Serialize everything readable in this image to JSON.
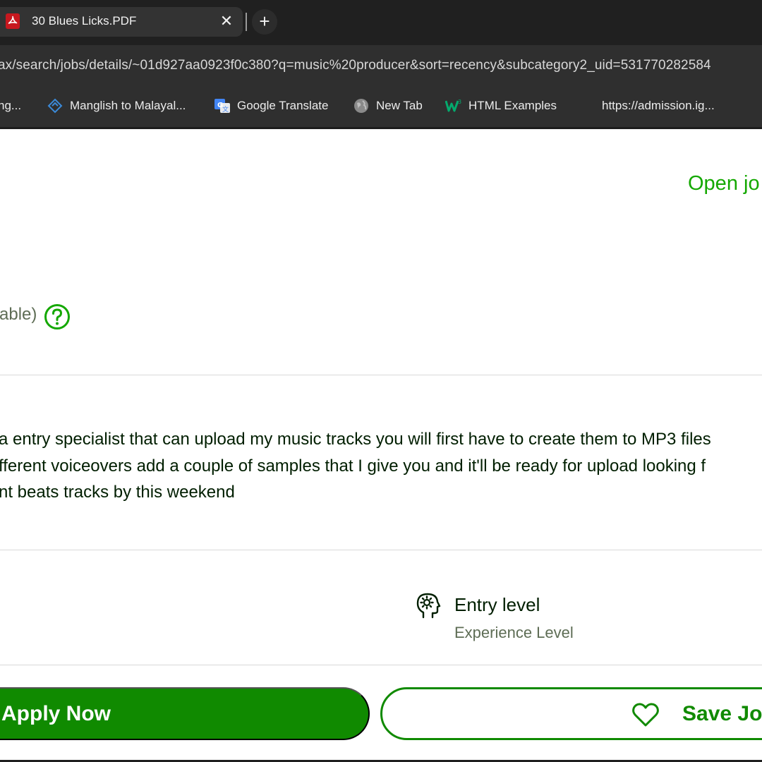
{
  "browser": {
    "tab": {
      "title": "30 Blues Licks.PDF",
      "close_glyph": "✕",
      "icon": "pdf-icon"
    },
    "new_tab_glyph": "+",
    "url": "ax/search/jobs/details/~01d927aa0923f0c380?q=music%20producer&sort=recency&subcategory2_uid=531770282584",
    "bookmarks": [
      {
        "label": "ng...",
        "icon": "none"
      },
      {
        "label": "Manglish to Malayal...",
        "icon": "diamond-icon"
      },
      {
        "label": "Google Translate",
        "icon": "google-translate-icon"
      },
      {
        "label": "New Tab",
        "icon": "globe-icon"
      },
      {
        "label": "HTML Examples",
        "icon": "w3schools-icon"
      },
      {
        "label": "https://admission.ig...",
        "icon": "none"
      }
    ]
  },
  "job": {
    "open_jobs_link": "Open jo",
    "payment_note": "able)",
    "description_lines": [
      "a entry specialist that can upload my music tracks you will first have to create them to MP3 files",
      "fferent voiceovers add a couple of samples that I give you and it'll be ready for upload looking f",
      "nt beats tracks by this weekend"
    ],
    "experience": {
      "value": "Entry level",
      "label": "Experience Level"
    },
    "actions": {
      "apply_label": "Apply Now",
      "save_label": "Save Job"
    }
  },
  "colors": {
    "accent": "#108a00",
    "link_green": "#14a800",
    "muted_text": "#5e6d55",
    "body_text": "#001e00",
    "chrome_dark": "#202020",
    "chrome_bar": "#2f2f2f"
  }
}
